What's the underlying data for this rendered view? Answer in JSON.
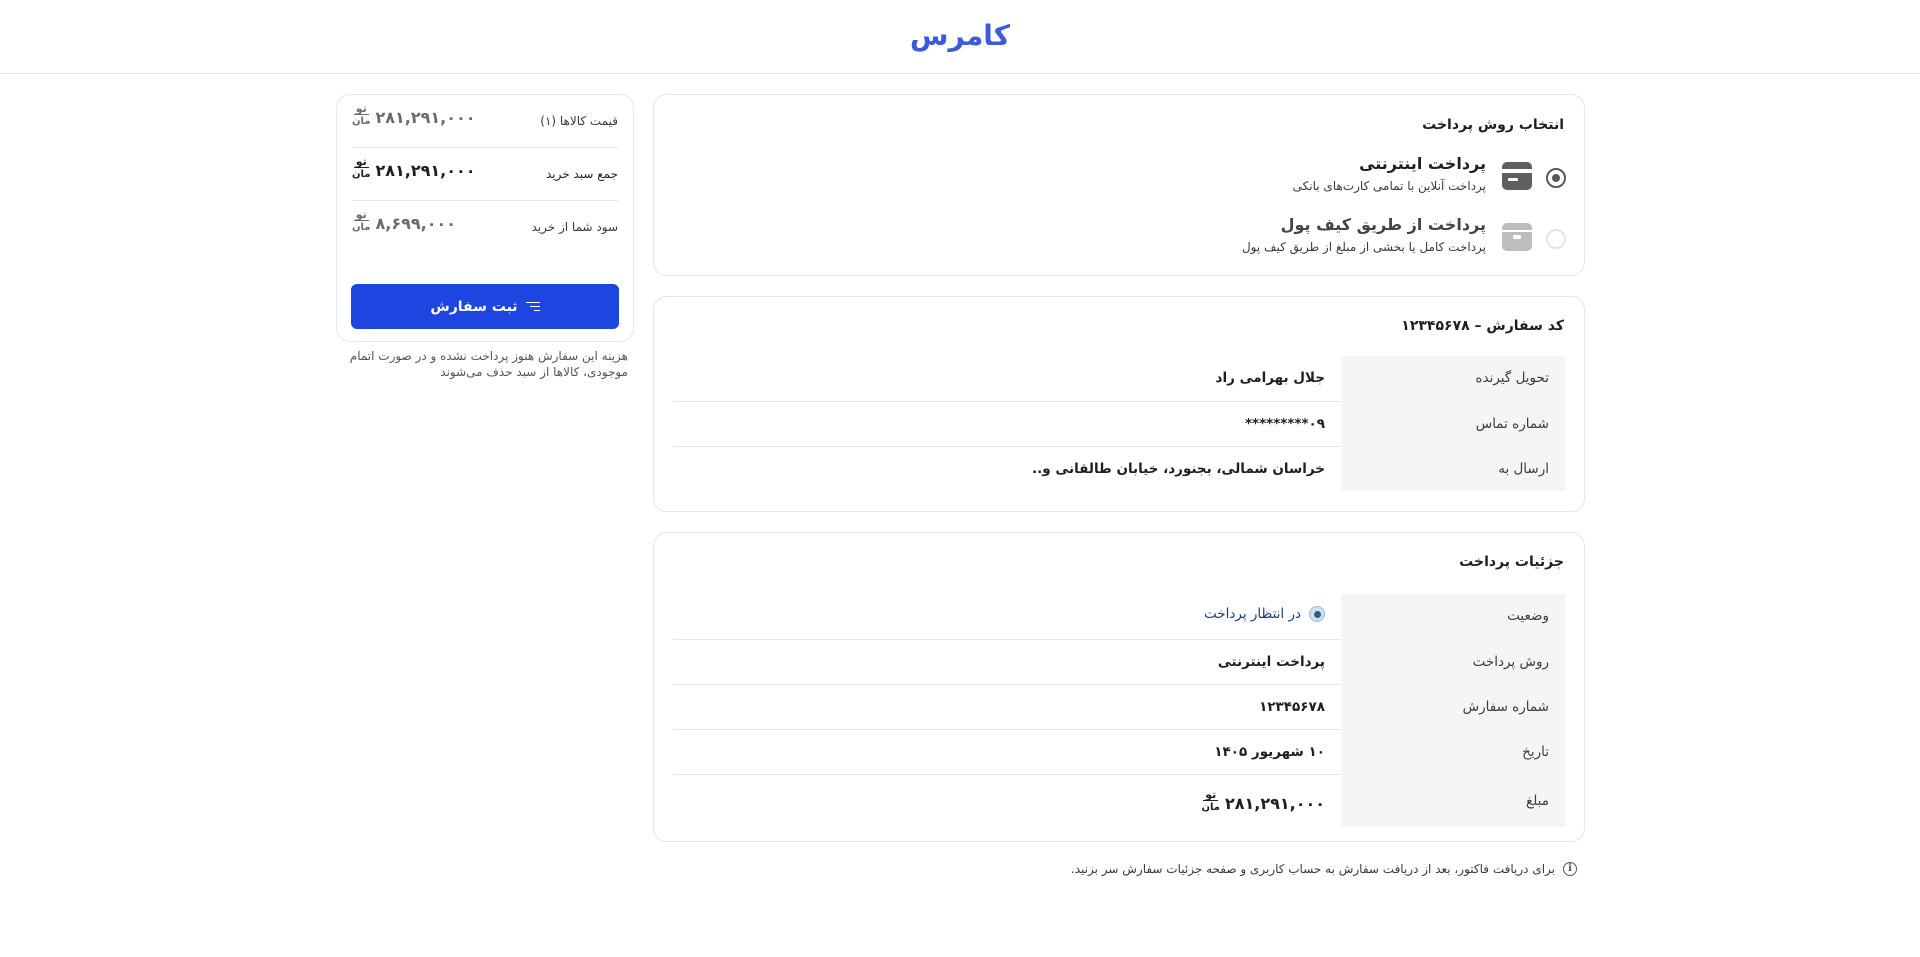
{
  "header": {
    "logo_text": "کامرس"
  },
  "payment_method": {
    "title": "انتخاب روش پرداخت",
    "options": [
      {
        "title": "پرداخت اینترنتی",
        "subtitle": "پرداخت آنلاین با تمامی کارت‌های بانکی",
        "icon": "card-icon",
        "selected": true
      },
      {
        "title": "پرداخت از طریق کیف پول",
        "subtitle": "پرداخت کامل یا بخشی از مبلغ از طریق کیف پول",
        "icon": "wallet-icon",
        "selected": false
      }
    ]
  },
  "order": {
    "title": "کد سفارش – ۱۲۳۴۵۶۷۸",
    "rows": [
      {
        "label": "تحویل گیرنده",
        "value": "جلال بهرامی راد"
      },
      {
        "label": "شماره تماس",
        "value": "۰۹*********"
      },
      {
        "label": "ارسال به",
        "value": "خراسان شمالی، بجنورد، خیابان طالقانی و.."
      }
    ]
  },
  "payment_details": {
    "title": "جزئیات پرداخت",
    "status_label": "وضعیت",
    "status_value": "در انتظار پرداخت",
    "method_label": "روش پرداخت",
    "method_value": "پرداخت اینترنتی",
    "order_number_label": "شماره سفارش",
    "order_number_value": "۱۲۳۴۵۶۷۸",
    "date_label": "تاریخ",
    "date_value": "۱۰ شهریور ۱۴۰۵",
    "amount_label": "مبلغ",
    "amount_value": "۲۸۱,۲۹۱,۰۰۰"
  },
  "currency": {
    "line1": "تو",
    "line2": "مان"
  },
  "invoice_note": "برای دریافت فاکتور، بعد از دریافت سفارش به حساب کاربری و صفحه جزئیات سفارش سر بزنید.",
  "summary": {
    "items_price_label": "قیمت کالاها (۱)",
    "items_price_value": "۲۸۱,۲۹۱,۰۰۰",
    "cart_total_label": "جمع سبد خرید",
    "cart_total_value": "۲۸۱,۲۹۱,۰۰۰",
    "savings_label": "سود شما از خرید",
    "savings_value": "۸,۶۹۹,۰۰۰",
    "submit_label": "ثبت سفارش",
    "note": "هزینه این سفارش هنوز پرداخت نشده و در صورت اتمام موجودی، کالاها از سبد حذف می‌شوند"
  },
  "colors": {
    "brand": "#3b5bdb",
    "primary_button": "#1d45e0",
    "status": "#2c5d86"
  }
}
